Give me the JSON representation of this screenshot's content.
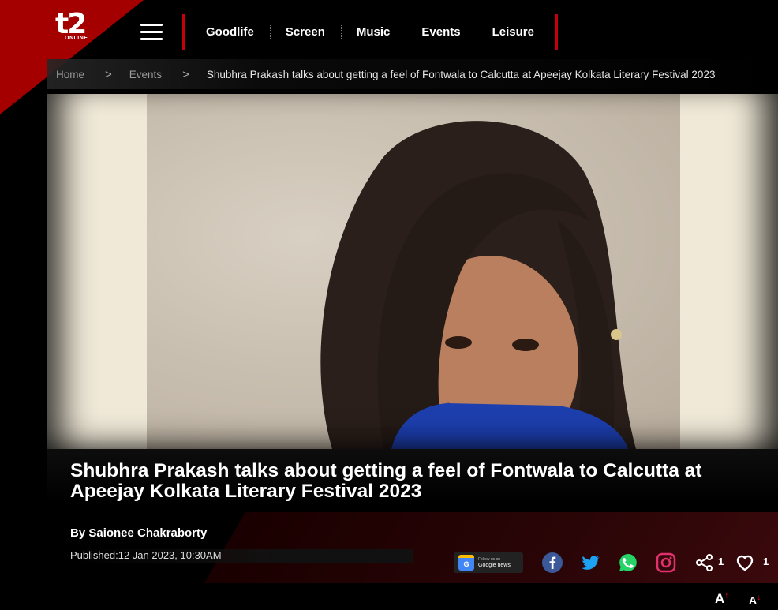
{
  "brand": {
    "logo_text": "t2",
    "logo_sub": "ONLINE"
  },
  "nav": {
    "items": [
      "Goodlife",
      "Screen",
      "Music",
      "Events",
      "Leisure"
    ]
  },
  "breadcrumb": {
    "home": "Home",
    "section": "Events",
    "current": "Shubhra Prakash talks about getting a feel of Fontwala to Calcutta at Apeejay Kolkata Literary Festival 2023",
    "separator": ">"
  },
  "article": {
    "headline": "Shubhra Prakash talks about getting a feel of Fontwala to Calcutta at Apeejay Kolkata Literary Festival 2023",
    "byline": "By Saionee Chakraborty",
    "published": "Published:12 Jan 2023, 10:30AM"
  },
  "google_news": {
    "small": "Follow us on",
    "big": "Google news",
    "badge": "G"
  },
  "social": {
    "share_count": "1",
    "like_count": "1"
  },
  "font_controls": {
    "increase": "A",
    "decrease": "A"
  },
  "colors": {
    "accent": "#c4000b",
    "facebook": "#3b5998",
    "twitter": "#1da1f2",
    "whatsapp": "#25d366",
    "instagram": "#e1306c"
  }
}
